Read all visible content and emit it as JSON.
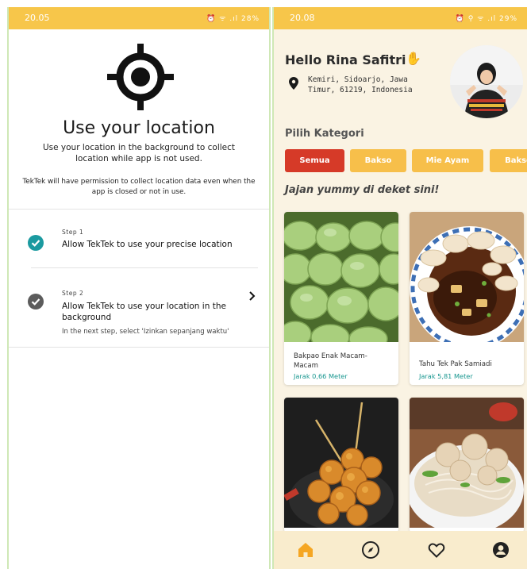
{
  "left": {
    "status_time": "20.05",
    "status_icons": "⏰ ᯤ .ıl 28%",
    "title": "Use your location",
    "description": "Use your location in the background to collect location while app is not used.",
    "note": "TekTek will have permission to collect location data even when the app is closed or not in use.",
    "steps": [
      {
        "number": "Step 1",
        "title": "Allow TekTek to use your precise location",
        "subtitle": "",
        "status": "done",
        "check_color": "#1b9aa0"
      },
      {
        "number": "Step 2",
        "title": "Allow TekTek to use your location in the background",
        "subtitle": "In the next step, select 'Izinkan sepanjang waktu'",
        "status": "done",
        "check_color": "#5c5c5c"
      }
    ]
  },
  "right": {
    "status_time": "20.08",
    "status_icons": "⏰ ⚲ ᯤ .ıl 29%",
    "greeting": "Hello Rina Safitri",
    "wave_icon": "waving-hand-icon",
    "address": "Kemiri, Sidoarjo, Jawa Timur, 61219, Indonesia",
    "category_title": "Pilih Kategori",
    "categories": [
      {
        "label": "Semua",
        "active": true
      },
      {
        "label": "Bakso",
        "active": false
      },
      {
        "label": "Mie Ayam",
        "active": false
      },
      {
        "label": "Bakso",
        "active": false
      }
    ],
    "nearby_title": "Jajan yummy di deket sini!",
    "foods": [
      {
        "name": "Bakpao Enak Macam-Macam",
        "distance": "Jarak 0,66 Meter"
      },
      {
        "name": "Tahu Tek Pak Samiadi",
        "distance": "Jarak 5,81 Meter"
      },
      {
        "name": "",
        "distance": ""
      },
      {
        "name": "",
        "distance": ""
      }
    ],
    "nav": [
      "home-icon",
      "compass-icon",
      "heart-icon",
      "profile-icon"
    ],
    "colors": {
      "accent": "#f7c64a",
      "active_chip": "#d63a28",
      "teal": "#17968f",
      "nav_active": "#f5a623"
    }
  }
}
